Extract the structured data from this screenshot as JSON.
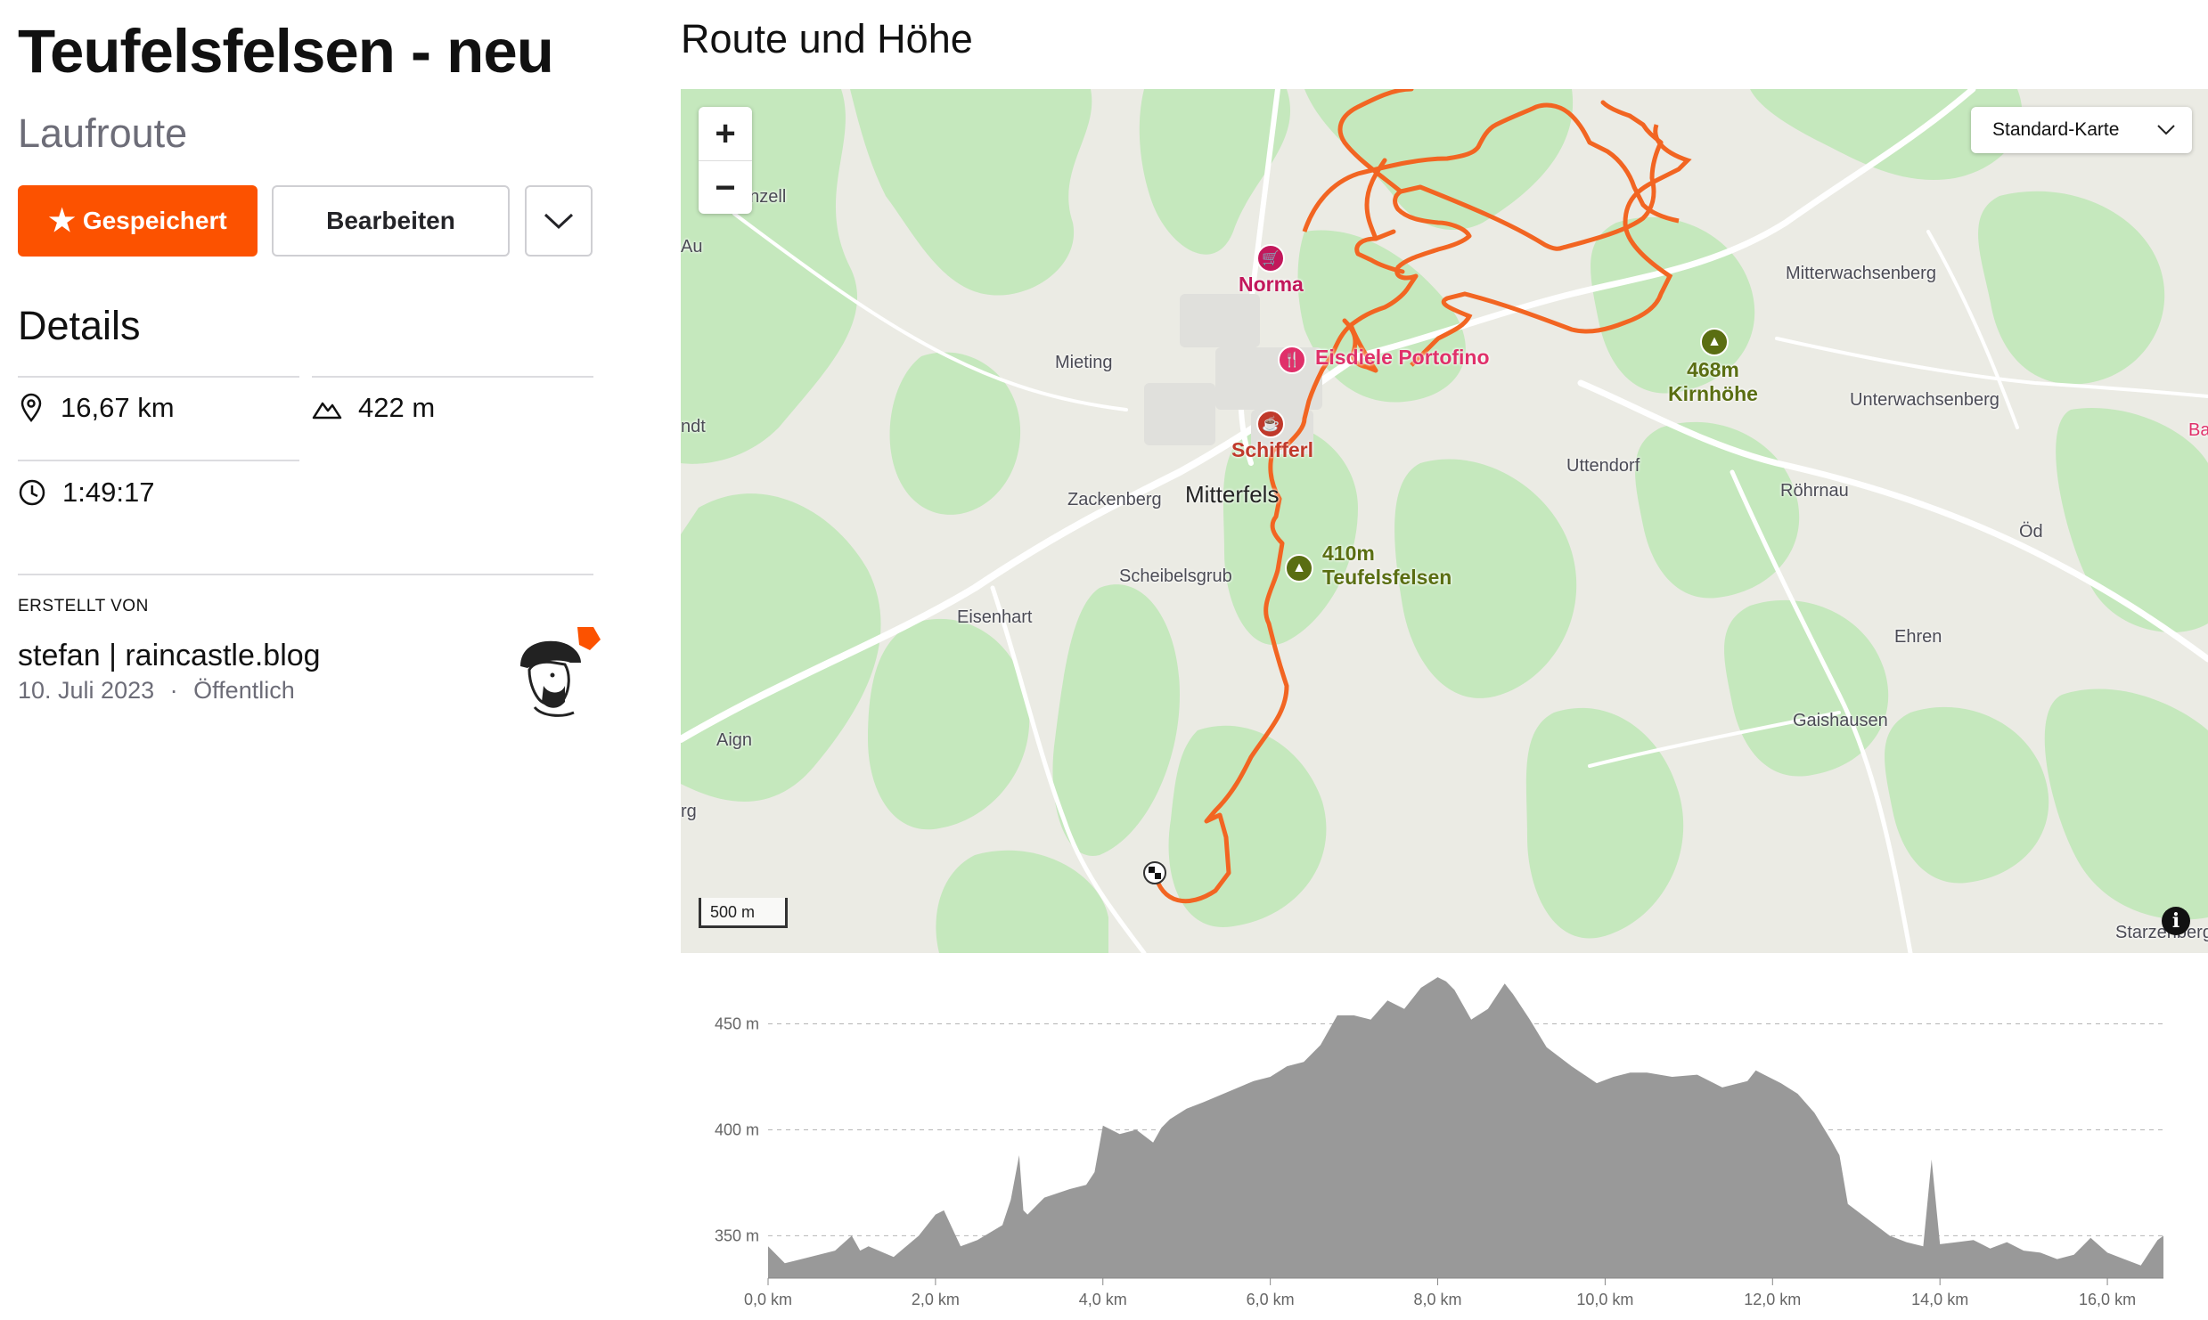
{
  "route": {
    "title": "Teufelsfelsen - neu",
    "type": "Laufroute"
  },
  "actions": {
    "saved_label": "Gespeichert",
    "edit_label": "Bearbeiten"
  },
  "details": {
    "heading": "Details",
    "distance": "16,67 km",
    "elevation_gain": "422 m",
    "duration": "1:49:17"
  },
  "creator": {
    "label": "ERSTELLT VON",
    "name": "stefan | raincastle.blog",
    "date": "10. Juli 2023",
    "separator": "·",
    "visibility": "Öffentlich"
  },
  "map": {
    "heading": "Route und Höhe",
    "map_type": "Standard-Karte",
    "scale": "500 m",
    "zoom_in": "+",
    "zoom_out": "−",
    "info": "i",
    "colors": {
      "route": "#f26522",
      "forest": "#c5e8bd",
      "land": "#ebebe4"
    },
    "places": [
      "enzell",
      "Au",
      "ndt",
      "Mieting",
      "Zackenberg",
      "Mitterfels",
      "Scheibelsgrub",
      "Eisenhart",
      "Aign",
      "rg",
      "Uttendorf",
      "Röhrnau",
      "Öd",
      "Ehren",
      "Gaishausen",
      "Mitterwachsenberg",
      "Unterwachsenberg",
      "Starzenberg",
      "Ba"
    ],
    "pois": [
      {
        "name": "Norma",
        "icon": "shopping-cart-icon",
        "color": "#c2185b"
      },
      {
        "name": "Eisdiele Portofino",
        "icon": "restaurant-icon",
        "color": "#e0306a"
      },
      {
        "name": "Schifferl",
        "icon": "cafe-icon",
        "color": "#c0392b"
      }
    ],
    "peaks": [
      {
        "elevation": "410m",
        "name": "Teufelsfelsen"
      },
      {
        "elevation": "468m",
        "name": "Kirnhöhe"
      }
    ]
  },
  "chart_data": {
    "type": "area",
    "title": "",
    "xlabel": "",
    "ylabel": "",
    "x_unit": "km",
    "y_unit": "m",
    "xlim": [
      0,
      16.67
    ],
    "ylim": [
      330,
      475
    ],
    "x_ticks": [
      "0,0 km",
      "2,0 km",
      "4,0 km",
      "6,0 km",
      "8,0 km",
      "10,0 km",
      "12,0 km",
      "14,0 km",
      "16,0 km"
    ],
    "y_ticks": [
      "350 m",
      "400 m",
      "450 m"
    ],
    "y_tick_values": [
      350,
      400,
      450
    ],
    "x": [
      0,
      0.2,
      0.5,
      0.8,
      1.0,
      1.1,
      1.2,
      1.5,
      1.8,
      2.0,
      2.1,
      2.3,
      2.5,
      2.8,
      2.9,
      3.0,
      3.05,
      3.1,
      3.3,
      3.6,
      3.8,
      3.9,
      4.0,
      4.2,
      4.4,
      4.6,
      4.7,
      4.8,
      5.0,
      5.2,
      5.5,
      5.8,
      6.0,
      6.2,
      6.4,
      6.6,
      6.8,
      7.0,
      7.2,
      7.4,
      7.6,
      7.8,
      8.0,
      8.1,
      8.2,
      8.4,
      8.6,
      8.8,
      8.9,
      9.1,
      9.3,
      9.6,
      9.9,
      10.1,
      10.3,
      10.5,
      10.8,
      11.1,
      11.4,
      11.7,
      11.8,
      11.9,
      12.1,
      12.3,
      12.5,
      12.7,
      12.8,
      12.9,
      13.0,
      13.2,
      13.4,
      13.6,
      13.8,
      13.9,
      14.0,
      14.2,
      14.4,
      14.6,
      14.8,
      15.0,
      15.2,
      15.4,
      15.6,
      15.8,
      16.0,
      16.2,
      16.4,
      16.6,
      16.67
    ],
    "y": [
      345,
      337,
      340,
      343,
      350,
      343,
      345,
      340,
      350,
      360,
      362,
      345,
      348,
      355,
      367,
      388,
      362,
      360,
      368,
      372,
      374,
      380,
      402,
      398,
      400,
      394,
      401,
      405,
      410,
      413,
      418,
      423,
      425,
      430,
      432,
      440,
      454,
      454,
      452,
      461,
      457,
      467,
      472,
      470,
      466,
      452,
      457,
      469,
      464,
      452,
      439,
      430,
      422,
      425,
      427,
      427,
      425,
      426,
      420,
      423,
      428,
      426,
      422,
      417,
      408,
      395,
      388,
      365,
      362,
      356,
      350,
      347,
      345,
      386,
      346,
      347,
      348,
      344,
      347,
      343,
      342,
      339,
      341,
      349,
      342,
      339,
      336,
      348,
      350
    ]
  }
}
